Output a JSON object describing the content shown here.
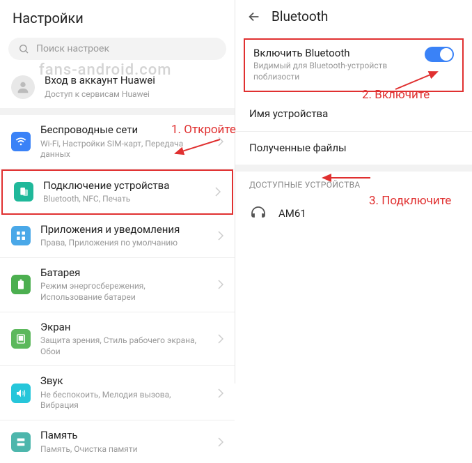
{
  "left": {
    "header": "Настройки",
    "search_placeholder": "Поиск настроек",
    "account": {
      "title": "Вход в аккаунт Huawei",
      "sub": "Доступ к сервисам Huawei"
    },
    "items": [
      {
        "title": "Беспроводные сети",
        "sub": "Wi-Fi, Настройки SIM-карт, Передача данных"
      },
      {
        "title": "Подключение устройства",
        "sub": "Bluetooth, NFC, Печать"
      },
      {
        "title": "Приложения и уведомления",
        "sub": "Права, Приложения по умолчанию"
      },
      {
        "title": "Батарея",
        "sub": "Режим энергосбережения, Использование батареи"
      },
      {
        "title": "Экран",
        "sub": "Защита зрения, Стиль рабочего экрана, Обои"
      },
      {
        "title": "Звук",
        "sub": "Не беспокоить, Мелодия вызова, Вибрация"
      },
      {
        "title": "Память",
        "sub": "Память, Очистка памяти"
      }
    ]
  },
  "right": {
    "header": "Bluetooth",
    "enable": {
      "title": "Включить Bluetooth",
      "sub": "Видимый для Bluetooth-устройств поблизости"
    },
    "device_name_label": "Имя устройства",
    "received_files_label": "Полученные файлы",
    "available_header": "ДОСТУПНЫЕ УСТРОЙСТВА",
    "device": "AM61"
  },
  "annotations": {
    "a1": "1. Откройте",
    "a2": "2. Включите",
    "a3": "3. Подключите"
  },
  "watermark": "fans-android.com"
}
